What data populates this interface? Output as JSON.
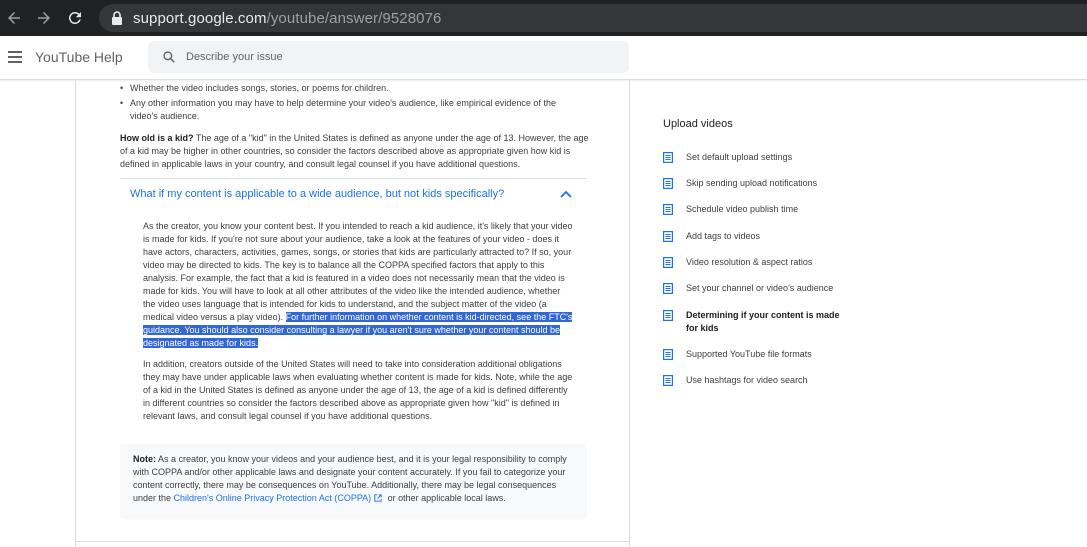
{
  "browser": {
    "url_host": "support.google.com",
    "url_path": "/youtube/answer/9528076"
  },
  "header": {
    "title": "YouTube Help",
    "search_placeholder": "Describe your issue"
  },
  "article": {
    "bullets": [
      "Whether the video includes songs, stories, or poems for children.",
      "Any other information you may have to help determine your video's audience, like empirical evidence of the video's audience."
    ],
    "kid_question": "How old is a kid?",
    "kid_answer": " The age of a \"kid\" in the United States is defined as anyone under the age of 13. However, the age of a kid may be higher in other countries, so consider the factors described above as appropriate given how kid is defined in applicable laws in your country, and consult legal counsel if you have additional questions.",
    "accordion_title": "What if my content is applicable to a wide audience, but not kids specifically?",
    "accordion_p1": "As the creator, you know your content best. If you intended to reach a kid audience, it's likely that your video is made for kids. If you're not sure about your audience, take a look at the features of your video - does it have actors, characters, activities, games, songs, or stories that kids are particularly attracted to? If so, your video may be directed to kids. The key is to balance all the COPPA specified factors that apply to this analysis. For example, the fact that a kid is featured in a video does not necessarily mean that the video is made for kids. You will have to look at all other attributes of the video like the intended audience, whether the video uses language that is intended for kids to understand, and the subject matter of the video (a medical video versus a play video). ",
    "accordion_p1_highlight": "For further information on whether content is kid-directed, see the FTC's guidance. You should also consider consulting a lawyer if you aren't sure whether your content should be designated as made for kids.",
    "accordion_p2": "In addition, creators outside of the United States will need to take into consideration additional obligations they may have under applicable laws when evaluating whether content is made for kids. Note, while the age of a kid in the United States is defined as anyone under the age of 13, the age of a kid is defined differently in different countries so consider the factors described above as appropriate given how \"kid\" is defined in relevant laws, and consult legal counsel if you have additional questions.",
    "note_label": "Note:",
    "note_text": " As a creator, you know your videos and your audience best, and it is your legal responsibility to comply with COPPA and/or other applicable laws and designate your content accurately. If you fail to  categorize your content correctly, there may be consequences on YouTube. Additionally, there may be legal consequences under the ",
    "note_link": "Children's Online Privacy Protection Act (COPPA)",
    "note_tail": " or other applicable local laws."
  },
  "sidebar": {
    "title": "Upload videos",
    "items": [
      {
        "label": "Set default upload settings"
      },
      {
        "label": "Skip sending upload notifications"
      },
      {
        "label": "Schedule video publish time"
      },
      {
        "label": "Add tags to videos"
      },
      {
        "label": "Video resolution & aspect ratios"
      },
      {
        "label": "Set your channel or video's audience"
      },
      {
        "label": "Determining if your content is made for kids"
      },
      {
        "label": "Supported YouTube file formats"
      },
      {
        "label": "Use hashtags for video search"
      }
    ]
  }
}
